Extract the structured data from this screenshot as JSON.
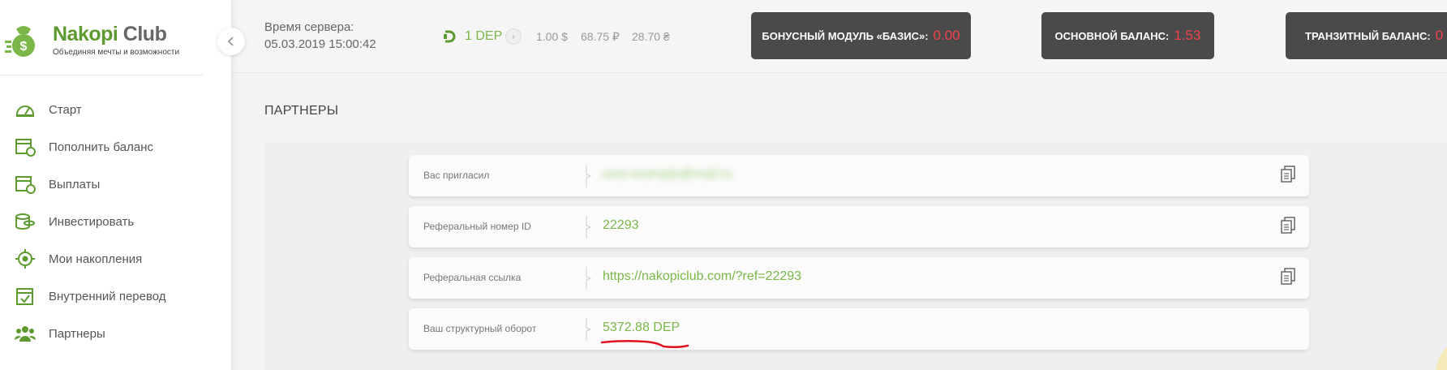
{
  "logo": {
    "name_part1": "Nakopi",
    "name_part2": " Club",
    "tagline": "Объединяя мечты и возможности"
  },
  "sidebar": {
    "items": [
      {
        "label": "Старт",
        "icon": "dashboard-icon"
      },
      {
        "label": "Пополнить баланс",
        "icon": "calendar-add-icon"
      },
      {
        "label": "Выплаты",
        "icon": "calendar-clock-icon"
      },
      {
        "label": "Инвестировать",
        "icon": "coins-icon"
      },
      {
        "label": "Мои накопления",
        "icon": "target-icon"
      },
      {
        "label": "Внутренний перевод",
        "icon": "calendar-check-icon"
      },
      {
        "label": "Партнеры",
        "icon": "people-icon"
      }
    ]
  },
  "topbar": {
    "server_time_label": "Время сервера:",
    "server_time_value": "05.03.2019 15:00:42",
    "dep_label": "1 DEP",
    "rate_usd": "1.00 $",
    "rate_rub": "68.75 ₽",
    "rate_uah": "28.70 ₴",
    "balances": [
      {
        "label": "БОНУСНЫЙ МОДУЛЬ «БАЗИС»:",
        "value": "0.00"
      },
      {
        "label": "ОСНОВНОЙ БАЛАНС:",
        "value": "1.53"
      },
      {
        "label": "ТРАНЗИТНЫЙ БАЛАНС:",
        "value": "0"
      }
    ]
  },
  "main": {
    "title": "ПАРТНЕРЫ",
    "rows": [
      {
        "label": "Вас пригласил",
        "value": "user.example@mail.ru",
        "copyable": true
      },
      {
        "label": "Реферальный номер ID",
        "value": "22293",
        "copyable": true
      },
      {
        "label": "Реферальная ссылка",
        "value": "https://nakopiclub.com/?ref=22293",
        "copyable": true
      },
      {
        "label": "Ваш структурный оборот",
        "value": "5372.88 DEP",
        "copyable": false
      }
    ]
  },
  "colors": {
    "accent": "#7ab648",
    "brand": "#5d9a2f",
    "balance_bg": "#4a4a4a",
    "balance_value": "#f5414b",
    "annotation": "#e0101e"
  }
}
